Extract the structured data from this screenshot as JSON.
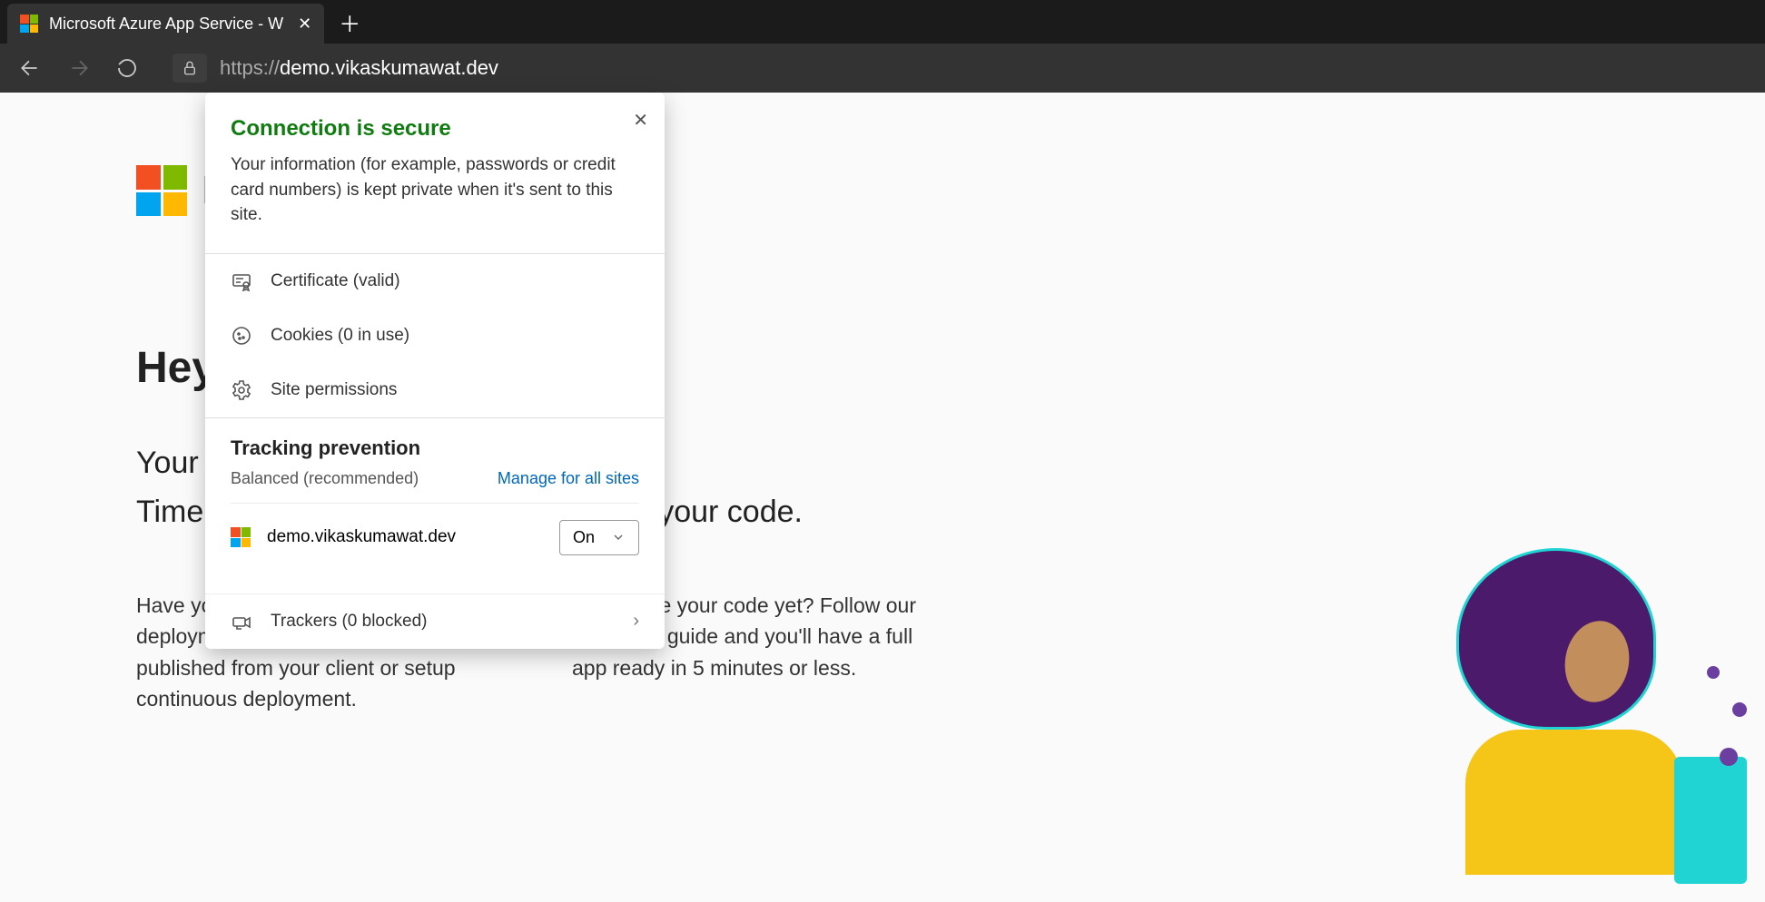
{
  "tab": {
    "title": "Microsoft Azure App Service - W"
  },
  "address": {
    "protocol": "https://",
    "host": "demo.vikaskumawat.dev"
  },
  "popup": {
    "title": "Connection is secure",
    "description": "Your information (for example, passwords or credit card numbers) is kept private when it's sent to this site.",
    "certificate": "Certificate (valid)",
    "cookies": "Cookies (0 in use)",
    "permissions": "Site permissions",
    "tracking": {
      "heading": "Tracking prevention",
      "mode": "Balanced (recommended)",
      "manage_link": "Manage for all sites",
      "site": "demo.vikaskumawat.dev",
      "toggle_value": "On",
      "trackers": "Trackers (0 blocked)"
    }
  },
  "page": {
    "brand": "Microsoft Azure",
    "greeting": "Hey, .NET developers!",
    "subline1": "Your app service is up and running.",
    "subline2": "Time to take the next step and deploy your code.",
    "col1": "Have your code ready?\nUse deployment center to get code published from your client or setup continuous deployment.",
    "col2": "Don't have your code yet?\nFollow our quickstart guide and you'll have a full app ready in 5 minutes or less."
  }
}
